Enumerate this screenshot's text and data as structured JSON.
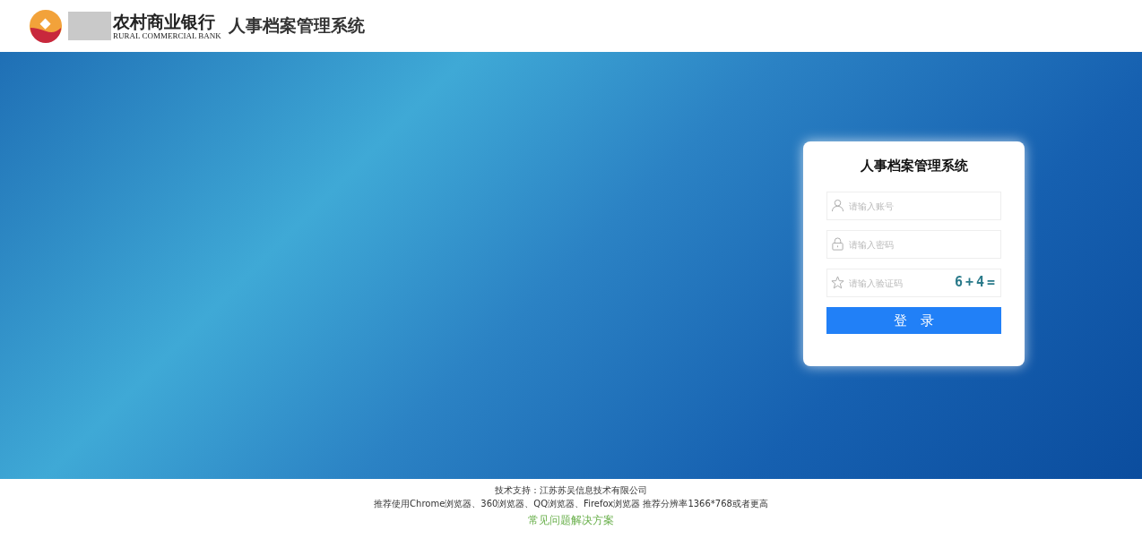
{
  "header": {
    "bank_name": "农村商业银行",
    "bank_name_en": "RURAL COMMERCIAL BANK",
    "system_title": "人事档案管理系统"
  },
  "login": {
    "title": "人事档案管理系统",
    "fields": [
      {
        "kind": "account",
        "placeholder": "请输入账号"
      },
      {
        "kind": "password",
        "placeholder": "请输入密码"
      },
      {
        "kind": "captcha",
        "placeholder": "请输入验证码",
        "captcha": "6+4="
      }
    ],
    "button": "登　录"
  },
  "footer": {
    "support": "技术支持：江苏苏吴信息技术有限公司",
    "browsers": "推荐使用Chrome浏览器、360浏览器、QQ浏览器、Firefox浏览器 推荐分辨率1366*768或者更高",
    "help_link": "常见问题解决方案"
  }
}
